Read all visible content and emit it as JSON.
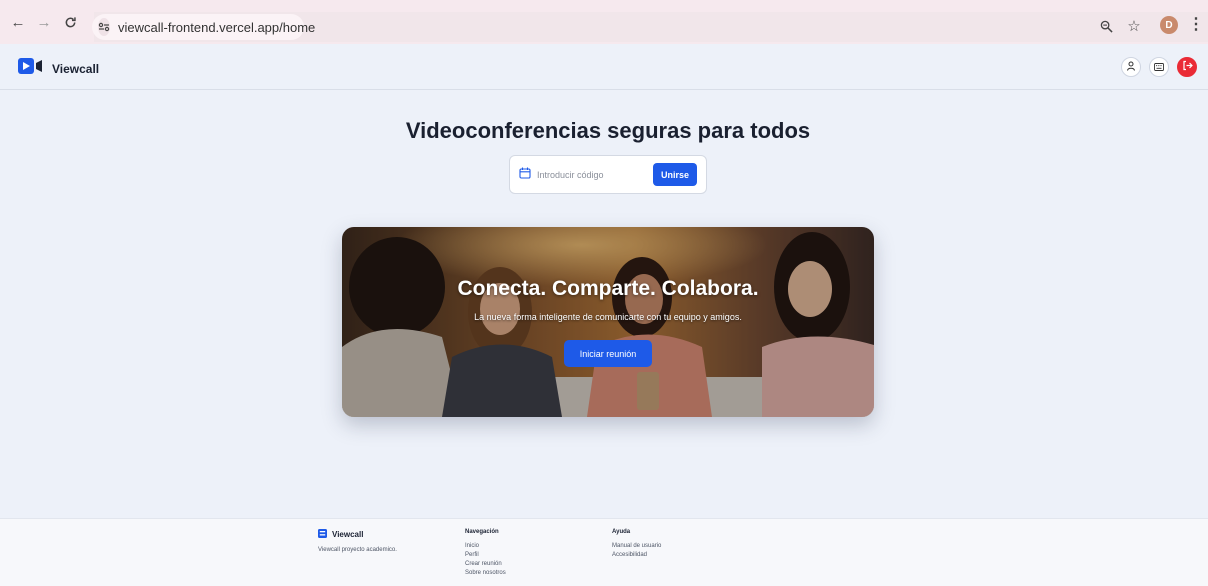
{
  "browser": {
    "url": "viewcall-frontend.vercel.app/home",
    "profile_initial": "D"
  },
  "header": {
    "app_name": "Viewcall"
  },
  "hero": {
    "title": "Videoconferencias seguras para todos",
    "code_placeholder": "Introducir código",
    "join_label": "Unirse"
  },
  "banner": {
    "heading": "Conecta. Comparte. Colabora.",
    "subtitle": "La nueva forma inteligente de comunicarte con tu equipo y amigos.",
    "start_label": "Iniciar reunión"
  },
  "footer": {
    "brand": "Viewcall",
    "description": "Viewcall proyecto academico.",
    "nav_title": "Navegación",
    "nav_links": [
      "Inicio",
      "Perfil",
      "Crear reunión",
      "Sobre nosotros"
    ],
    "help_title": "Ayuda",
    "help_links": [
      "Manual de usuario",
      "Accesibilidad"
    ]
  },
  "colors": {
    "primary": "#1e5ae8",
    "danger": "#ea2b36",
    "background": "#edf1f9"
  }
}
